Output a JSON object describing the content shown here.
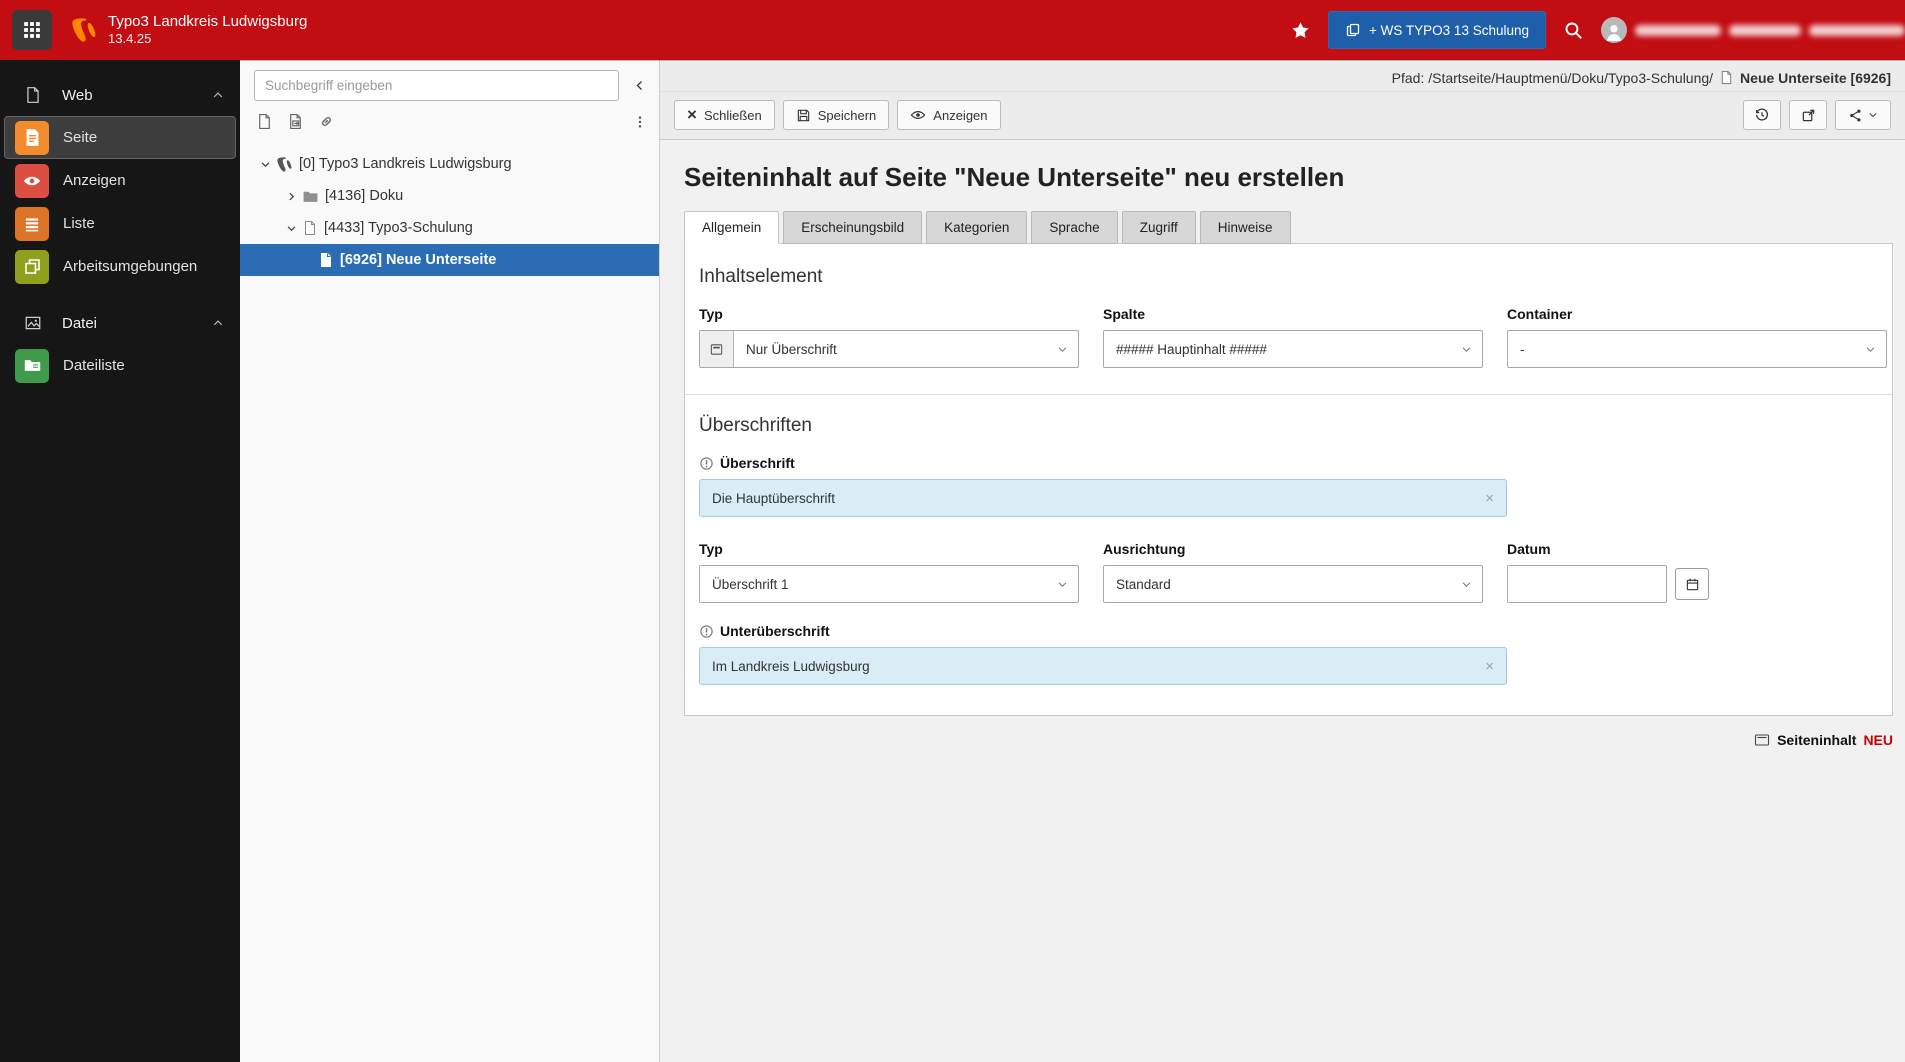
{
  "topbar": {
    "site_title": "Typo3 Landkreis Ludwigsburg",
    "version": "13.4.25",
    "workspace_button_label": "+ WS TYPO3 13 Schulung"
  },
  "module_menu": {
    "groups": [
      {
        "label": "Web",
        "items": [
          {
            "label": "Seite",
            "color": "#f28c2c",
            "active": true
          },
          {
            "label": "Anzeigen",
            "color": "#dc4e41"
          },
          {
            "label": "Liste",
            "color": "#dd7327"
          },
          {
            "label": "Arbeitsumgebungen",
            "color": "#8fa11c"
          }
        ]
      },
      {
        "label": "Datei",
        "items": [
          {
            "label": "Dateiliste",
            "color": "#3f9b49"
          }
        ]
      }
    ]
  },
  "pagetree": {
    "search_placeholder": "Suchbegriff eingeben",
    "nodes": [
      "[0] Typo3 Landkreis Ludwigsburg",
      "[4136] Doku",
      "[4433] Typo3-Schulung",
      "[6926] Neue Unterseite"
    ]
  },
  "docheader": {
    "path_prefix": "Pfad: /Startseite/Hauptmenü/Doku/Typo3-Schulung/",
    "record_title": "Neue Unterseite [6926]",
    "close_label": "Schließen",
    "save_label": "Speichern",
    "view_label": "Anzeigen"
  },
  "content": {
    "page_title": "Seiteninhalt auf Seite \"Neue Unterseite\" neu erstellen",
    "tabs": [
      "Allgemein",
      "Erscheinungsbild",
      "Kategorien",
      "Sprache",
      "Zugriff",
      "Hinweise"
    ],
    "inhaltselement": {
      "heading": "Inhaltselement",
      "typ_label": "Typ",
      "typ_value": "Nur Überschrift",
      "spalte_label": "Spalte",
      "spalte_value": "##### Hauptinhalt #####",
      "container_label": "Container",
      "container_value": "-"
    },
    "ueberschriften": {
      "heading": "Überschriften",
      "ueberschrift_label": "Überschrift",
      "ueberschrift_value": "Die Hauptüberschrift",
      "typ_label": "Typ",
      "typ_value": "Überschrift 1",
      "ausrichtung_label": "Ausrichtung",
      "ausrichtung_value": "Standard",
      "datum_label": "Datum",
      "datum_value": "",
      "unterueberschrift_label": "Unterüberschrift",
      "unterueberschrift_value": "Im Landkreis Ludwigsburg"
    }
  },
  "footer": {
    "record_type": "Seiteninhalt",
    "badge": "NEU"
  },
  "colors": {
    "topbar_red": "#c20d12",
    "workspace_button_blue": "#1f5fa9",
    "tree_selection_blue": "#2a6db5",
    "changed_field_bg": "#d9edf7",
    "typo3_orange": "#ff8700"
  }
}
